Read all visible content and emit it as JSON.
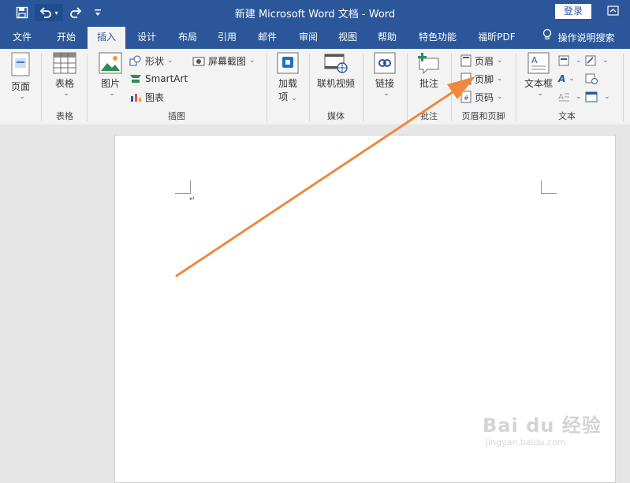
{
  "window": {
    "title": "新建 Microsoft Word 文档 - Word",
    "login_label": "登录"
  },
  "quick_access": {
    "save_icon": "save-icon",
    "undo_icon": "undo-icon",
    "redo_icon": "redo-icon",
    "customize_icon": "customize-qat-icon"
  },
  "tabs": [
    "文件",
    "开始",
    "插入",
    "设计",
    "布局",
    "引用",
    "邮件",
    "审阅",
    "视图",
    "帮助",
    "特色功能",
    "福昕PDF"
  ],
  "active_tab": "插入",
  "tell_me": "操作说明搜索",
  "ribbon": {
    "pages": {
      "label": "页面"
    },
    "tables": {
      "button": "表格",
      "group": "表格"
    },
    "illustrations": {
      "picture": "图片",
      "shapes": "形状",
      "smartart": "SmartArt",
      "chart": "图表",
      "screenshot": "屏幕截图",
      "group": "插图"
    },
    "addins": {
      "label_line1": "加载",
      "label_line2": "项"
    },
    "media": {
      "button": "联机视频",
      "group": "媒体"
    },
    "links": {
      "button": "链接"
    },
    "comments": {
      "button": "批注",
      "group": "批注"
    },
    "header_footer": {
      "header": "页眉",
      "footer": "页脚",
      "page_number": "页码",
      "group": "页眉和页脚"
    },
    "text": {
      "textbox": "文本框",
      "group": "文本"
    }
  },
  "document": {
    "paragraph_mark": "↵"
  },
  "annotation": {
    "color": "#f0883e"
  },
  "watermark": {
    "brand": "Bai du 经验",
    "url": "jingyan.baidu.com"
  }
}
